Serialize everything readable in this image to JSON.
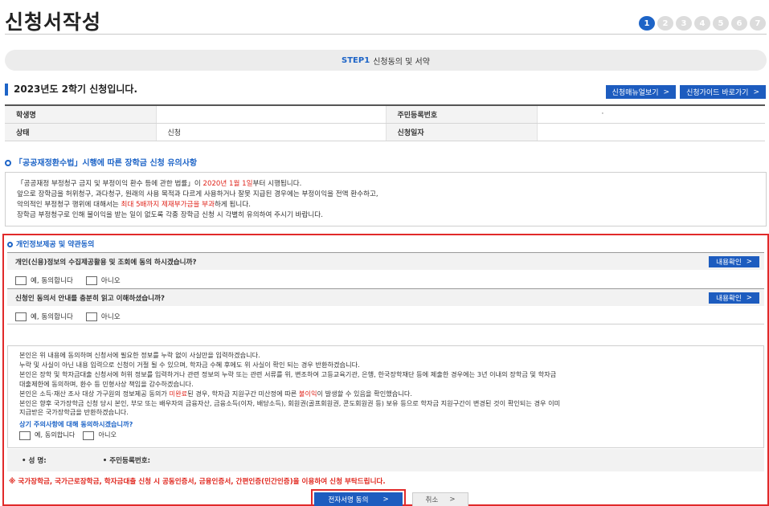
{
  "page": {
    "title": "신청서작성"
  },
  "steps": [
    "1",
    "2",
    "3",
    "4",
    "5",
    "6",
    "7"
  ],
  "step_banner": {
    "label": "STEP1",
    "text": "신청동의 및 서약"
  },
  "semester": "2023년도 2학기 신청입니다.",
  "buttons": {
    "manual": "신청매뉴얼보기",
    "guide": "신청가이드 바로가기",
    "view": "내용확인",
    "sign": "전자서명 동의",
    "cancel": "취소",
    "chevron": ">"
  },
  "info_table": {
    "name_label": "학생명",
    "name_value": "",
    "rrn_label": "주민등록번호",
    "rrn_value": "·",
    "status_label": "상태",
    "status_value": "신청",
    "date_label": "신청일자",
    "date_value": ""
  },
  "notice": {
    "title": "「공공재정환수법」시행에 따른 장학금 신청 유의사항",
    "line1_a": "「공공재정 부정청구 금지 및 부정이익 환수 등에 관한 법률」이 ",
    "line1_red": "2020년 1월 1일",
    "line1_b": "부터 시행됩니다.",
    "line2": "앞으로 장학금을 허위청구, 과다청구, 원래의 사용 목적과 다르게 사용하거나 잘못 지급된 경우에는 부정이익을 전액 환수하고,",
    "line3_a": "악의적인 부정청구 행위에 대해서는 ",
    "line3_red": "최대 5배까지 제재부가금을 부과",
    "line3_b": "하게 됩니다.",
    "line4": "장학금 부정청구로 인해 불이익을 받는 일이 없도록 각종 장학금 신청 시 각별히 유의하여 주시기 바랍니다."
  },
  "consent": {
    "title": "개인정보제공 및 약관동의",
    "q1": "개인(신용)정보의 수집제공활용 및 조회에 동의 하시겠습니까?",
    "q2": "신청인 동의서 안내를 충분히 읽고 이해하셨습니까?",
    "yes": "예, 동의합니다",
    "no": "아니오",
    "agree_lines": [
      "본인은 위 내용에 동의하며 신청서에 필요한 정보를 누락 없이 사실만을 입력하겠습니다.",
      "누락 및 사실이 아닌 내용 입력으로 신청이 거절 될 수 있으며, 학자금 수혜 후에도 위 사실이 확인 되는 경우 반환하겠습니다.",
      "본인은 장학 및 학자금대출 신청서에 허위 정보를 입력하거나 관련 정보의 누락 또는 관련 서류를 위, 변조하여 고등교육기관, 은행, 한국장학재단 등에 제출한 경우에는 3년 이내의 장학금 및 학자금",
      "대출제한에 동의하며, 환수 등 민형사상 책임을 감수하겠습니다."
    ],
    "agree_line5_a": "본인은 소득·재산 조사 대상 가구원의 정보제공 동의가 ",
    "agree_line5_red1": "미완료",
    "agree_line5_b": "된 경우, 학자금 지원구간 미산정에 따른 ",
    "agree_line5_red2": "불이익",
    "agree_line5_c": "이 발생할 수 있음을 확인했습니다.",
    "agree_line6": "본인은 향후 국가장학금 신청 당시 본인, 부모 또는 배우자의 금융자산, 금융소득(이자, 배당소득), 회원권(골프회원권, 콘도회원권 등) 보유 등으로 학자금 지원구간이 변경된 것이 확인되는 경우 이미",
    "agree_line7": "지급받은 국가장학금을 반환하겠습니다.",
    "agree_question": "상기 주의사항에 대해 동의하시겠습니까?",
    "sign_name": "• 성 명:",
    "sign_rrn": "• 주민등록번호:",
    "warning": "※ 국가장학금, 국가근로장학금, 학자금대출 신청 시 공동인증서, 금융인증서, 간편인증(민간인증)을 이용하여 신청 부탁드립니다."
  },
  "colors": {
    "accent": "#1d64c7",
    "button": "#1d5cbf",
    "alert": "#e0261d",
    "highlight_border": "#e12a2a"
  }
}
